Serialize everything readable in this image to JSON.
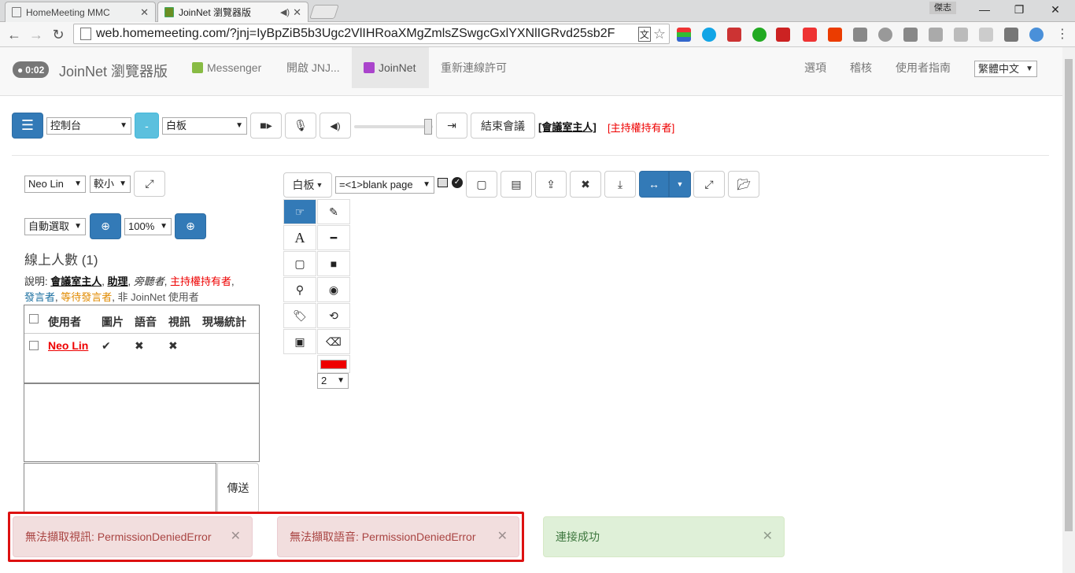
{
  "browser": {
    "tabs": [
      {
        "title": "HomeMeeting MMC"
      },
      {
        "title": "JoinNet 瀏覽器版"
      }
    ],
    "user_badge": "傑志",
    "url": "web.homemeeting.com/?jnj=IyBpZiB5b3Ugc2VlIHRoaXMgZmlsZSwgcGxlYXNlIGRvd25sb2F"
  },
  "nav": {
    "timer": "0:02",
    "brand": "JoinNet 瀏覽器版",
    "links": [
      "Messenger",
      "開啟 JNJ...",
      "JoinNet",
      "重新連線許可"
    ],
    "right_links": [
      "選項",
      "稽核",
      "使用者指南"
    ],
    "language": "繁體中文"
  },
  "controls": {
    "panel_select": "控制台",
    "minus": "-",
    "board_select": "白板",
    "end_meeting": "結束會議",
    "role_owner": "[會議室主人]",
    "role_host": "[主持權持有者]"
  },
  "left": {
    "user_select": "Neo Lin",
    "size_select": "較小",
    "auto_select": "自動選取",
    "zoom_select": "100%",
    "online_count": "線上人數 (1)",
    "legend_prefix": "說明:",
    "legend_owner": "會議室主人",
    "legend_assistant": "助理",
    "legend_observer": "旁聽者",
    "legend_host": "主持權持有者",
    "legend_speaker": "發言者",
    "legend_waiting": "等待發言者",
    "legend_nonjoinnet": "非 JoinNet 使用者",
    "columns": [
      "使用者",
      "圖片",
      "語音",
      "視訊",
      "現場統計"
    ],
    "rows": [
      {
        "user": "Neo Lin",
        "picture": "✔",
        "audio": "✖",
        "video": "✖",
        "stats": ""
      }
    ],
    "send": "傳送"
  },
  "whiteboard": {
    "mode_select": "白板",
    "page_select": "=<1>blank page",
    "stroke_width": "2",
    "pen_color": "#ee0000"
  },
  "toasts": [
    {
      "text": "無法擷取視訊: PermissionDeniedError",
      "type": "error"
    },
    {
      "text": "無法擷取語音: PermissionDeniedError",
      "type": "error"
    },
    {
      "text": "連接成功",
      "type": "success"
    }
  ]
}
